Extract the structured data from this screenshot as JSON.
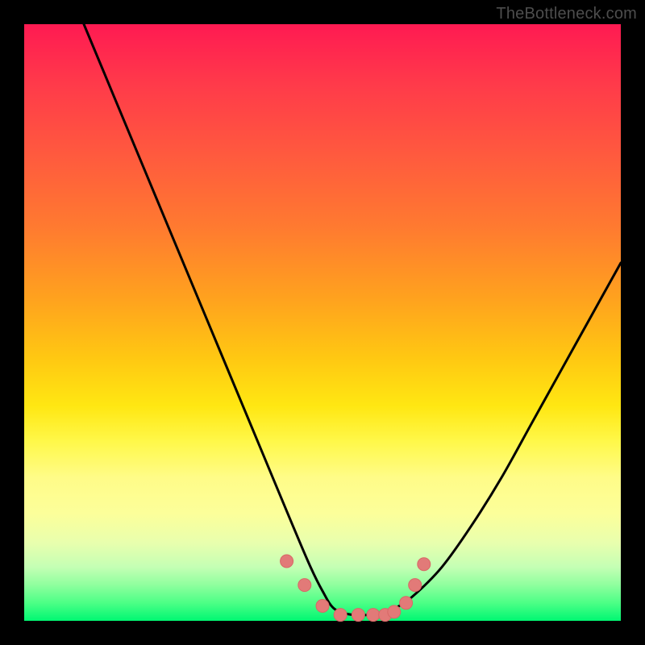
{
  "watermark": "TheBottleneck.com",
  "colors": {
    "frame": "#000000",
    "curve_stroke": "#000000",
    "marker_fill": "#e27a78",
    "marker_stroke": "#d86866",
    "gradient_top": "#ff1a52",
    "gradient_bottom": "#00f772"
  },
  "chart_data": {
    "type": "line",
    "title": "",
    "xlabel": "",
    "ylabel": "",
    "xlim": [
      0,
      100
    ],
    "ylim": [
      0,
      100
    ],
    "grid": false,
    "legend": false,
    "annotations": [
      "TheBottleneck.com"
    ],
    "series": [
      {
        "name": "bottleneck-curve",
        "x": [
          10,
          15,
          20,
          25,
          30,
          35,
          40,
          45,
          48,
          50,
          52,
          55,
          58,
          60,
          62,
          65,
          70,
          75,
          80,
          85,
          90,
          95,
          100
        ],
        "values": [
          100,
          88,
          76,
          64,
          52,
          40,
          28,
          16,
          9,
          5,
          2,
          1,
          1,
          1,
          2,
          4,
          9,
          16,
          24,
          33,
          42,
          51,
          60
        ]
      }
    ],
    "markers": {
      "name": "valley-markers",
      "x": [
        44,
        47,
        50,
        53,
        56,
        58.5,
        60.5,
        62,
        64,
        65.5,
        67
      ],
      "values": [
        10,
        6,
        2.5,
        1,
        1,
        1,
        1,
        1.5,
        3,
        6,
        9.5
      ]
    }
  }
}
